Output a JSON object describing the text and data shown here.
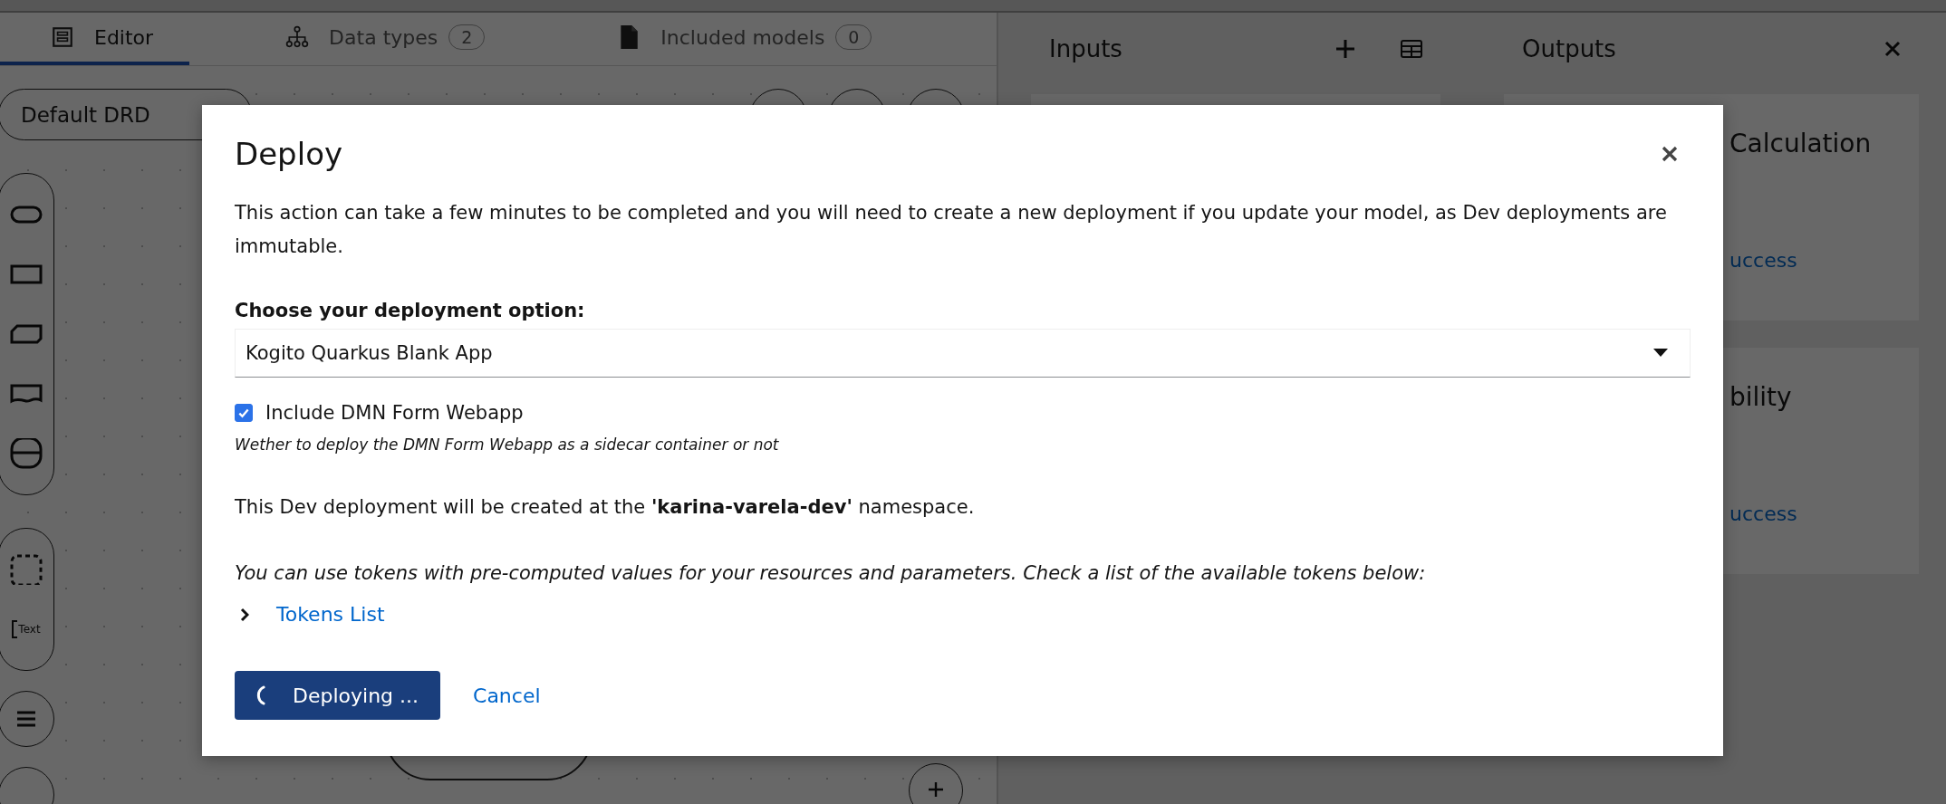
{
  "editor": {
    "tabs": [
      {
        "kind": "editor",
        "label": "Editor",
        "selected": true
      },
      {
        "kind": "data-types",
        "label": "Data types",
        "count": "2",
        "selected": false
      },
      {
        "kind": "included-models",
        "label": "Included models",
        "count": "0",
        "selected": false
      }
    ],
    "drd_selector": "Default DRD",
    "palette": [
      {
        "items": [
          {
            "kind": "input-data"
          },
          {
            "kind": "decision"
          },
          {
            "kind": "knowledge-source"
          },
          {
            "kind": "document"
          },
          {
            "kind": "decision-service"
          }
        ]
      },
      {
        "items": [
          {
            "kind": "group"
          },
          {
            "kind": "text-annotation",
            "label": "Text"
          }
        ]
      }
    ]
  },
  "side_panel": {
    "inputs_title": "Inputs",
    "outputs_title": "Outputs",
    "output_cards": [
      {
        "title": "Calculation",
        "link": "uccess"
      },
      {
        "title": "bility",
        "link": "uccess"
      }
    ]
  },
  "modal": {
    "title": "Deploy",
    "description": "This action can take a few minutes to be completed and you will need to create a new deployment if you update your model, as Dev deployments are immutable.",
    "select_label": "Choose your deployment option:",
    "select_value": "Kogito Quarkus Blank App",
    "checkbox": {
      "label": "Include DMN Form Webapp",
      "checked": true
    },
    "checkbox_help": "Wether to deploy the DMN Form Webapp as a sidecar container or not",
    "namespace_text": "This Dev deployment will be created at the **'karina-varela-dev'** namespace.",
    "tokens_note": "You can use tokens with pre-computed values for your resources and parameters. Check a list of the available tokens below:",
    "tokens_toggle": {
      "label": "Tokens List",
      "expanded": false
    },
    "primary_button": {
      "label": "Deploying ...",
      "loading": true
    },
    "cancel_button": "Cancel"
  }
}
